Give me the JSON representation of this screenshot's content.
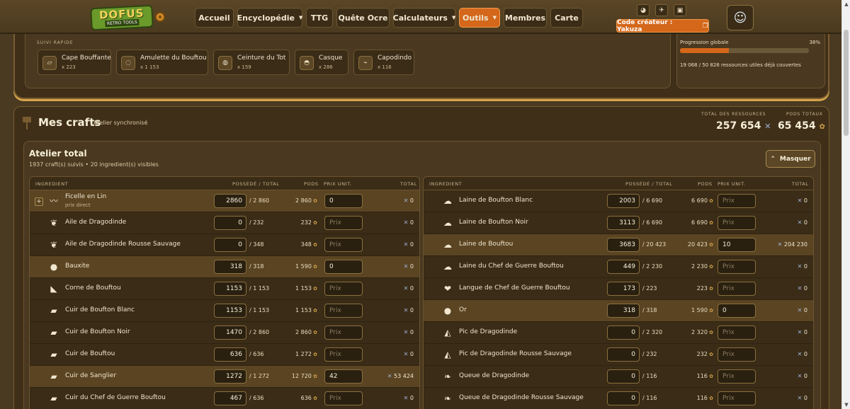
{
  "nav": {
    "logo_line1": "DOFUS",
    "logo_line2": "RETRO TOOLS",
    "items": [
      {
        "label": "Accueil",
        "caret": false
      },
      {
        "label": "Encyclopédie",
        "caret": true
      },
      {
        "label": "TTG",
        "caret": false
      },
      {
        "label": "Quête Ocre",
        "caret": false
      },
      {
        "label": "Calculateurs",
        "caret": true
      },
      {
        "label": "Outils",
        "caret": true,
        "active": true
      },
      {
        "label": "Membres",
        "caret": false
      },
      {
        "label": "Carte",
        "caret": false
      }
    ],
    "creator_code": "Code créateur : Yakuza"
  },
  "quick": {
    "title": "SUIVI RAPIDE",
    "items": [
      {
        "name": "Cape Bouffante",
        "count": "x 223"
      },
      {
        "name": "Amulette du Bouftou",
        "count": "x 1 153"
      },
      {
        "name": "Ceinture du Tot",
        "count": "x 159"
      },
      {
        "name": "Casque",
        "count": "x 286"
      },
      {
        "name": "Capodindo",
        "count": "x 116"
      }
    ]
  },
  "progress": {
    "label": "Progression globale",
    "percent_text": "38%",
    "fraction": 0.38,
    "sub": "19 068 / 50 826 ressources utiles déjà couvertes"
  },
  "craft": {
    "title": "Mes crafts",
    "sync": "Atelier synchronisé",
    "total_resources_label": "TOTAL DES RESSOURCES",
    "total_resources": "257 654",
    "total_pods_label": "PODS TOTAUX",
    "total_pods": "65 454"
  },
  "atelier": {
    "title": "Atelier total",
    "sub": "1937 craft(s) suivis • 20 ingredient(s) visibles",
    "hide_label": "Masquer",
    "headers": {
      "ingredient": "INGREDIENT",
      "owned": "POSSÉDÉ / TOTAL",
      "pods": "PODS",
      "unit": "PRIX UNIT.",
      "total": "TOTAL"
    },
    "price_placeholder": "Prix",
    "left": [
      {
        "name": "Ficelle en Lin",
        "sub": "prix direct",
        "owned": "2860",
        "total": "/ 2 860",
        "pods": "2 860",
        "price": "0",
        "sum": "0",
        "icon": "〰",
        "expand": true,
        "hl": true
      },
      {
        "name": "Aile de Dragodinde",
        "owned": "0",
        "total": "/ 232",
        "pods": "232",
        "price": "",
        "sum": "0",
        "icon": "❦"
      },
      {
        "name": "Aile de Dragodinde Rousse Sauvage",
        "owned": "0",
        "total": "/ 348",
        "pods": "348",
        "price": "",
        "sum": "0",
        "icon": "❦"
      },
      {
        "name": "Bauxite",
        "owned": "318",
        "total": "/ 318",
        "pods": "1 590",
        "price": "0",
        "sum": "0",
        "icon": "●",
        "hl": true
      },
      {
        "name": "Corne de Bouftou",
        "owned": "1153",
        "total": "/ 1 153",
        "pods": "1 153",
        "price": "",
        "sum": "0",
        "icon": "◣"
      },
      {
        "name": "Cuir de Boufton Blanc",
        "owned": "1153",
        "total": "/ 1 153",
        "pods": "1 153",
        "price": "",
        "sum": "0",
        "icon": "▰"
      },
      {
        "name": "Cuir de Boufton Noir",
        "owned": "1470",
        "total": "/ 2 860",
        "pods": "2 860",
        "price": "",
        "sum": "0",
        "icon": "▰"
      },
      {
        "name": "Cuir de Bouftou",
        "owned": "636",
        "total": "/ 636",
        "pods": "1 272",
        "price": "",
        "sum": "0",
        "icon": "▰"
      },
      {
        "name": "Cuir de Sanglier",
        "owned": "1272",
        "total": "/ 1 272",
        "pods": "12 720",
        "price": "42",
        "sum": "53 424",
        "icon": "▰",
        "hl": true
      },
      {
        "name": "Cuir du Chef de Guerre Bouftou",
        "owned": "467",
        "total": "/ 636",
        "pods": "636",
        "price": "",
        "sum": "0",
        "icon": "▰"
      }
    ],
    "right": [
      {
        "name": "Laine de Boufton Blanc",
        "owned": "2003",
        "total": "/ 6 690",
        "pods": "6 690",
        "price": "",
        "sum": "0",
        "icon": "☁"
      },
      {
        "name": "Laine de Boufton Noir",
        "owned": "3113",
        "total": "/ 6 690",
        "pods": "6 690",
        "price": "",
        "sum": "0",
        "icon": "☁"
      },
      {
        "name": "Laine de Bouftou",
        "owned": "3683",
        "total": "/ 20 423",
        "pods": "20 423",
        "price": "10",
        "sum": "204 230",
        "icon": "☁",
        "hl": true
      },
      {
        "name": "Laine du Chef de Guerre Bouftou",
        "owned": "449",
        "total": "/ 2 230",
        "pods": "2 230",
        "price": "",
        "sum": "0",
        "icon": "☁"
      },
      {
        "name": "Langue de Chef de Guerre Bouftou",
        "owned": "173",
        "total": "/ 223",
        "pods": "223",
        "price": "",
        "sum": "0",
        "icon": "❤"
      },
      {
        "name": "Or",
        "owned": "318",
        "total": "/ 318",
        "pods": "1 590",
        "price": "0",
        "sum": "0",
        "icon": "●",
        "hl": true
      },
      {
        "name": "Pic de Dragodinde",
        "owned": "0",
        "total": "/ 2 320",
        "pods": "2 320",
        "price": "",
        "sum": "0",
        "icon": "◭"
      },
      {
        "name": "Pic de Dragodinde Rousse Sauvage",
        "owned": "0",
        "total": "/ 232",
        "pods": "232",
        "price": "",
        "sum": "0",
        "icon": "◭"
      },
      {
        "name": "Queue de Dragodinde",
        "owned": "0",
        "total": "/ 116",
        "pods": "116",
        "price": "",
        "sum": "0",
        "icon": "❧"
      },
      {
        "name": "Queue de Dragodinde Rousse Sauvage",
        "owned": "0",
        "total": "/ 116",
        "pods": "116",
        "price": "",
        "sum": "0",
        "icon": "❧"
      }
    ]
  },
  "colors": {
    "accent": "#d4671a",
    "background": "#4a3a22",
    "panel": "#3f2f19",
    "highlight_row": "#5a4422"
  },
  "icons": {
    "kama": "kama-icon",
    "pods": "pods-icon",
    "copy": "copy-icon",
    "discord": "discord-icon",
    "twitter": "twitter-icon",
    "twitch": "twitch-icon",
    "chevron_up": "chevron-up-icon"
  }
}
